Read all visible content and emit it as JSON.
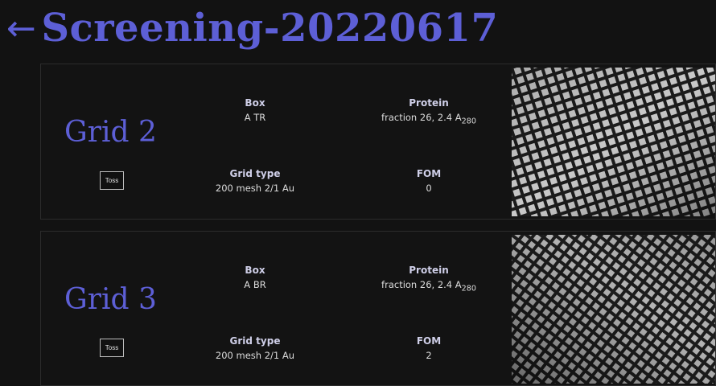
{
  "header": {
    "back_icon": "←",
    "title": "Screening-20220617"
  },
  "labels": {
    "box": "Box",
    "protein": "Protein",
    "grid_type": "Grid type",
    "fom": "FOM",
    "toss": "Toss"
  },
  "grids": [
    {
      "title": "Grid 2",
      "box": "A TR",
      "protein_text": "fraction 26, 2.4 A",
      "protein_sub": "280",
      "grid_type": "200 mesh 2/1 Au",
      "fom": "0"
    },
    {
      "title": "Grid 3",
      "box": "A BR",
      "protein_text": "fraction 26, 2.4 A",
      "protein_sub": "280",
      "grid_type": "200 mesh 2/1 Au",
      "fom": "2"
    }
  ],
  "colors": {
    "accent": "#5d5fd6",
    "background": "#121212"
  },
  "icons": {
    "back": "left-arrow-icon",
    "thumbnail": "atlas-image"
  }
}
